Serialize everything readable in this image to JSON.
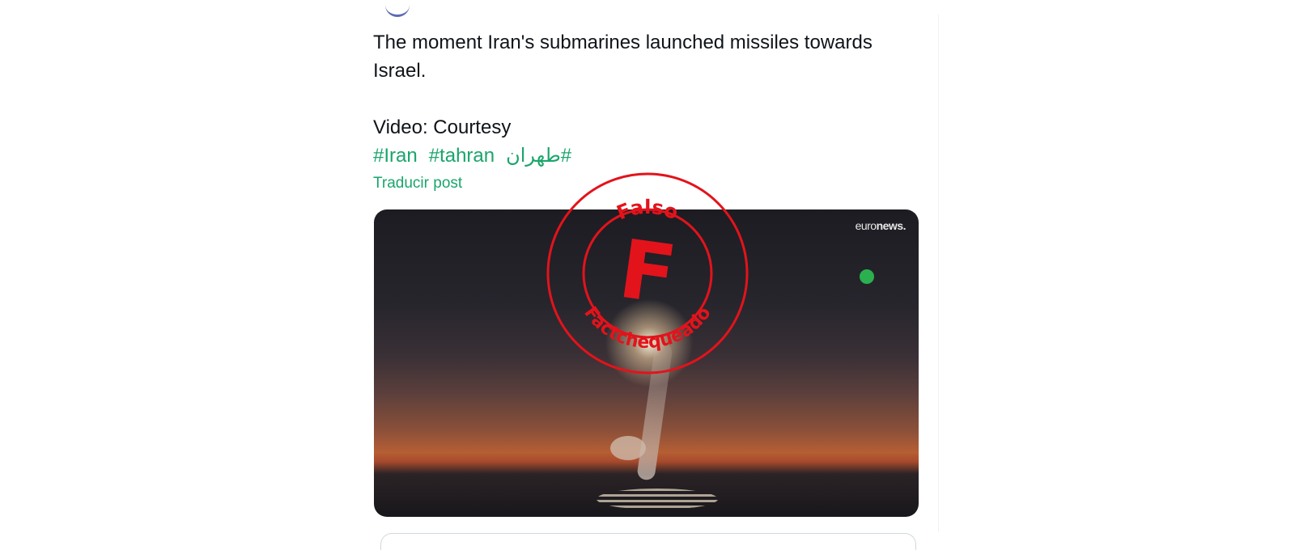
{
  "post": {
    "text_line1": "The moment Iran's submarines launched missiles towards",
    "text_line2": "Israel.",
    "text_line3": "Video: Courtesy",
    "hashtags": [
      "#Iran",
      "#tahran",
      "#طهران"
    ],
    "translate_label": "Traducir post"
  },
  "media": {
    "watermark_light": "euro",
    "watermark_bold": "news."
  },
  "stamp": {
    "top_text": "Falso",
    "letter": "F",
    "bottom_text": "Factchequeado",
    "color": "#e3131b"
  },
  "colors": {
    "hashtag": "#1aa56c",
    "text": "#0f1419",
    "status_dot": "#2bb04f"
  }
}
